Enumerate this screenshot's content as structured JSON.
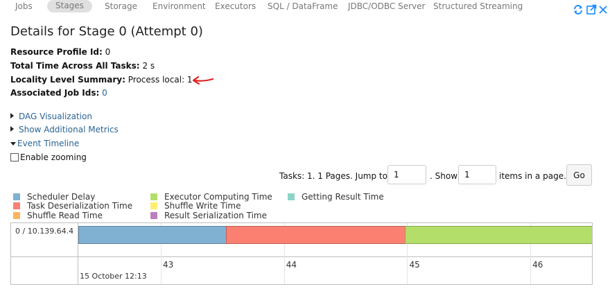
{
  "nav": {
    "items": [
      {
        "label": "Jobs",
        "active": false
      },
      {
        "label": "Stages",
        "active": true
      },
      {
        "label": "Storage",
        "active": false
      },
      {
        "label": "Environment",
        "active": false
      },
      {
        "label": "Executors",
        "active": false
      },
      {
        "label": "SQL / DataFrame",
        "active": false
      },
      {
        "label": "JDBC/ODBC Server",
        "active": false
      },
      {
        "label": "Structured Streaming",
        "active": false
      }
    ],
    "icons": [
      "refresh-icon",
      "open-external-icon",
      "close-icon"
    ],
    "icon_color": "#1a8cff"
  },
  "page": {
    "title": "Details for Stage 0 (Attempt 0)"
  },
  "summary": {
    "resource_profile": {
      "label": "Resource Profile Id:",
      "value": "0"
    },
    "total_time": {
      "label": "Total Time Across All Tasks:",
      "value": "2 s"
    },
    "locality": {
      "label": "Locality Level Summary:",
      "value": "Process local: 1"
    },
    "job_ids": {
      "label": "Associated Job Ids:",
      "value": "0"
    }
  },
  "annotation": {
    "arrow_color": "#e0201e"
  },
  "expanders": {
    "dag": "DAG Visualization",
    "metrics": "Show Additional Metrics",
    "timeline": "Event Timeline"
  },
  "zoom": {
    "label": "Enable zooming",
    "checked": false
  },
  "pagination": {
    "tasks_text": "Tasks: 1. 1 Pages. Jump to",
    "jump_value": "1",
    "show_text": ". Show",
    "show_value": "1",
    "items_text": "items in a page.",
    "go_label": "Go"
  },
  "legend": [
    {
      "label": "Scheduler Delay",
      "color": "#80b1d3"
    },
    {
      "label": "Task Deserialization Time",
      "color": "#fb8072"
    },
    {
      "label": "Shuffle Read Time",
      "color": "#fdb462"
    },
    {
      "label": "Executor Computing Time",
      "color": "#b3de69"
    },
    {
      "label": "Shuffle Write Time",
      "color": "#ffed6f"
    },
    {
      "label": "Result Serialization Time",
      "color": "#bc80bd"
    },
    {
      "label": "Getting Result Time",
      "color": "#8dd3c7"
    }
  ],
  "timeline": {
    "group_label": "0 / 10.139.64.4",
    "date_label": "15 October 12:13",
    "ticks": [
      "43",
      "44",
      "45",
      "46"
    ],
    "tick_seconds": [
      43,
      44,
      45,
      46
    ],
    "axis_start_seconds": 42.33,
    "axis_end_seconds": 46.5,
    "task": {
      "segments": [
        {
          "name": "Scheduler Delay",
          "start": 42.33,
          "end": 43.53,
          "color": "#80b1d3"
        },
        {
          "name": "Task Deserialization Time",
          "start": 43.53,
          "end": 44.98,
          "color": "#fb8072"
        },
        {
          "name": "Executor Computing Time",
          "start": 44.98,
          "end": 46.5,
          "color": "#b3de69"
        }
      ]
    }
  }
}
